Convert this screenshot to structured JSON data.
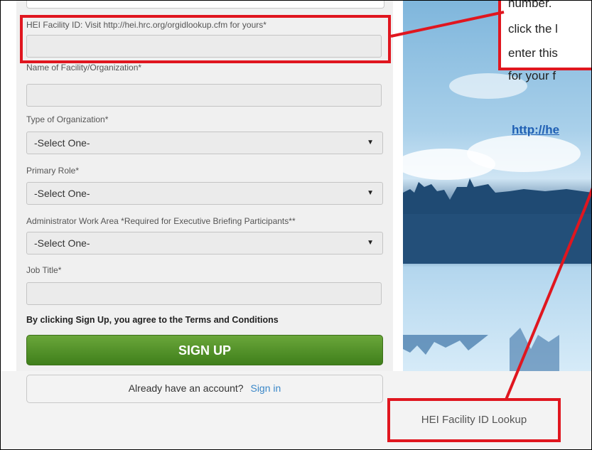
{
  "form": {
    "facility_id_label": "HEI Facility ID: Visit http://hei.hrc.org/orgidlookup.cfm for yours*",
    "facility_name_label": "Name of Facility/Organization*",
    "org_type_label": "Type of Organization*",
    "org_type_value": "-Select One-",
    "primary_role_label": "Primary Role*",
    "primary_role_value": "-Select One-",
    "admin_area_label": "Administrator Work Area *Required for Executive Briefing Participants**",
    "admin_area_value": "-Select One-",
    "job_title_label": "Job Title*",
    "terms_text": "By clicking Sign Up, you agree to the  Terms and Conditions",
    "signup_label": "SIGN UP",
    "account_prompt": "Already have an account?",
    "signin_label": "Sign in"
  },
  "callout": {
    "line1": "number.",
    "line2": "click the l",
    "line3": "enter this",
    "line4": "for your f",
    "url": "http://he"
  },
  "footer": {
    "lookup_link": "HEI Facility ID Lookup"
  },
  "colors": {
    "highlight": "#e0161f",
    "signup_green": "#4e8f27",
    "link_blue": "#3a87c8"
  },
  "icons": {
    "select_arrow": "dropdown-arrow-icon"
  }
}
